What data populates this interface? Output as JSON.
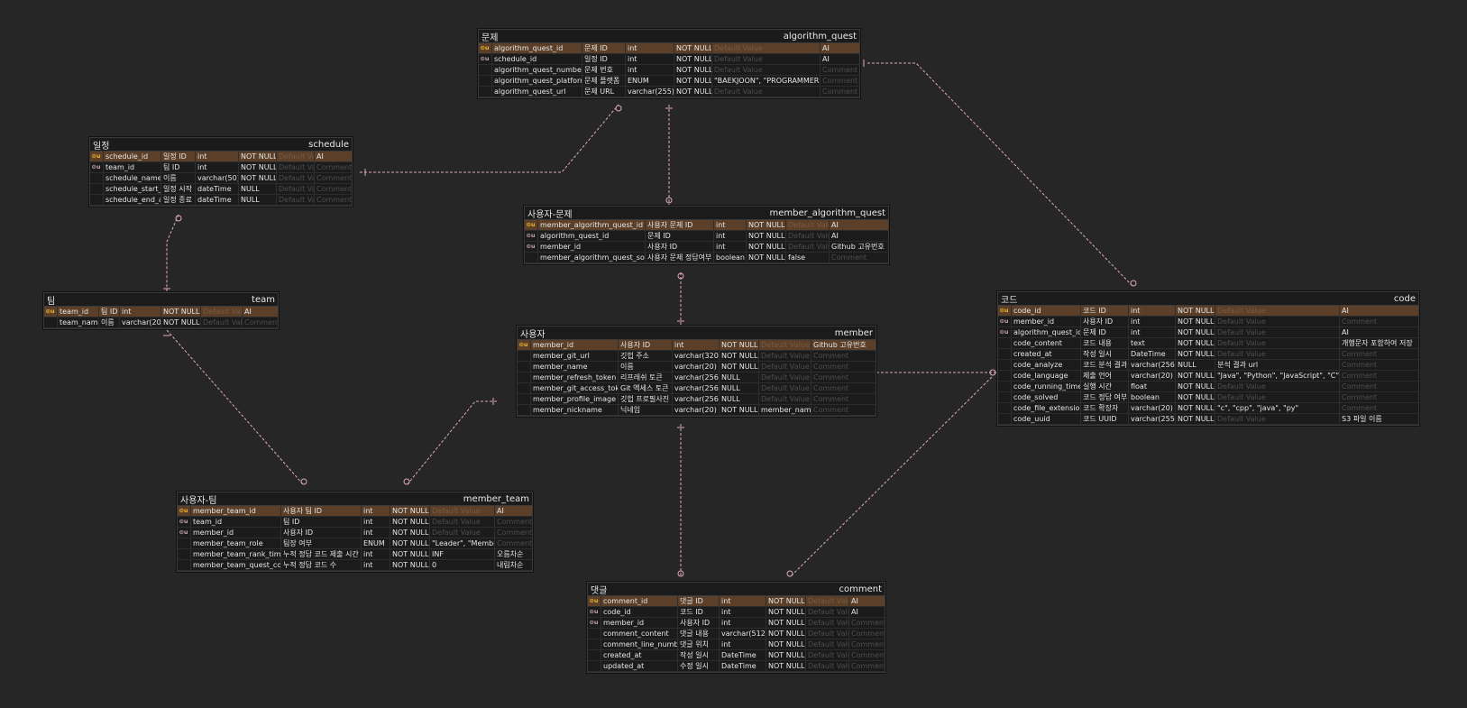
{
  "placeholders": {
    "default": "Default Value",
    "comment": "Comment"
  },
  "colors": {
    "background": "#262626",
    "table": "#1b1b1b",
    "pk_row": "#5b3f28",
    "relation": "#e0a8c0"
  },
  "tables": [
    {
      "id": "algorithm_quest",
      "label": "문제",
      "name": "algorithm_quest",
      "rows": [
        {
          "key": "pk",
          "col": "algorithm_quest_id",
          "logical": "문제 ID",
          "type": "int",
          "null": "NOT NULL",
          "def": "",
          "comment": "AI"
        },
        {
          "key": "fk",
          "col": "schedule_id",
          "logical": "일정 ID",
          "type": "int",
          "null": "NOT NULL",
          "def": "",
          "comment": "AI"
        },
        {
          "key": "",
          "col": "algorithm_quest_number",
          "logical": "문제 번호",
          "type": "int",
          "null": "NOT NULL",
          "def": "",
          "comment": ""
        },
        {
          "key": "",
          "col": "algorithm_quest_platform",
          "logical": "문제 플랫폼",
          "type": "ENUM",
          "null": "NOT NULL",
          "def": "\"BAEKJOON\", \"PROGRAMMERS\"",
          "comment": ""
        },
        {
          "key": "",
          "col": "algorithm_quest_url",
          "logical": "문제 URL",
          "type": "varchar(255)",
          "null": "NOT NULL",
          "def": "",
          "comment": ""
        }
      ]
    },
    {
      "id": "schedule",
      "label": "일정",
      "name": "schedule",
      "rows": [
        {
          "key": "pk",
          "col": "schedule_id",
          "logical": "일정 ID",
          "type": "int",
          "null": "NOT NULL",
          "def": "",
          "comment": "AI"
        },
        {
          "key": "fk",
          "col": "team_id",
          "logical": "팀 ID",
          "type": "int",
          "null": "NOT NULL",
          "def": "",
          "comment": ""
        },
        {
          "key": "",
          "col": "schedule_name",
          "logical": "이름",
          "type": "varchar(50)",
          "null": "NOT NULL",
          "def": "",
          "comment": ""
        },
        {
          "key": "",
          "col": "schedule_start_at",
          "logical": "일정 시작",
          "type": "dateTime",
          "null": "NULL",
          "def": "",
          "comment": ""
        },
        {
          "key": "",
          "col": "schedule_end_at",
          "logical": "일정 종료",
          "type": "dateTime",
          "null": "NULL",
          "def": "",
          "comment": ""
        }
      ]
    },
    {
      "id": "member_algorithm_quest",
      "label": "사용자-문제",
      "name": "member_algorithm_quest",
      "rows": [
        {
          "key": "pk",
          "col": "member_algorithm_quest_id",
          "logical": "사용자 문제 ID",
          "type": "int",
          "null": "NOT NULL",
          "def": "",
          "comment": "AI"
        },
        {
          "key": "fk",
          "col": "algorithm_quest_id",
          "logical": "문제 ID",
          "type": "int",
          "null": "NOT NULL",
          "def": "",
          "comment": "AI"
        },
        {
          "key": "fk",
          "col": "member_id",
          "logical": "사용자 ID",
          "type": "int",
          "null": "NOT NULL",
          "def": "",
          "comment": "Github 고유번호"
        },
        {
          "key": "",
          "col": "member_algorithm_quest_solved",
          "logical": "사용자 문제 정답여부",
          "type": "boolean",
          "null": "NOT NULL",
          "def": "false",
          "comment": ""
        }
      ]
    },
    {
      "id": "team",
      "label": "팀",
      "name": "team",
      "rows": [
        {
          "key": "pk",
          "col": "team_id",
          "logical": "팀 ID",
          "type": "int",
          "null": "NOT NULL",
          "def": "",
          "comment": "AI"
        },
        {
          "key": "",
          "col": "team_name",
          "logical": "이름",
          "type": "varchar(20)",
          "null": "NOT NULL",
          "def": "",
          "comment": ""
        }
      ]
    },
    {
      "id": "member",
      "label": "사용자",
      "name": "member",
      "rows": [
        {
          "key": "pk",
          "col": "member_id",
          "logical": "사용자 ID",
          "type": "int",
          "null": "NOT NULL",
          "def": "",
          "comment": "Github 고유번호"
        },
        {
          "key": "",
          "col": "member_git_url",
          "logical": "깃헙 주소",
          "type": "varchar(320)",
          "null": "NOT NULL",
          "def": "",
          "comment": ""
        },
        {
          "key": "",
          "col": "member_name",
          "logical": "이름",
          "type": "varchar(20)",
          "null": "NOT NULL",
          "def": "",
          "comment": ""
        },
        {
          "key": "",
          "col": "member_refresh_token",
          "logical": "리프레쉬 토큰",
          "type": "varchar(256)",
          "null": "NULL",
          "def": "",
          "comment": ""
        },
        {
          "key": "",
          "col": "member_git_access_token",
          "logical": "Git 엑세스 토큰",
          "type": "varchar(256)",
          "null": "NULL",
          "def": "",
          "comment": ""
        },
        {
          "key": "",
          "col": "member_profile_image",
          "logical": "깃헙 프로필사진",
          "type": "varchar(256)",
          "null": "NULL",
          "def": "",
          "comment": ""
        },
        {
          "key": "",
          "col": "member_nickname",
          "logical": "닉네임",
          "type": "varchar(20)",
          "null": "NOT NULL",
          "def": "member_name",
          "comment": ""
        }
      ]
    },
    {
      "id": "code",
      "label": "코드",
      "name": "code",
      "rows": [
        {
          "key": "pk",
          "col": "code_id",
          "logical": "코드 ID",
          "type": "int",
          "null": "NOT NULL",
          "def": "",
          "comment": "AI"
        },
        {
          "key": "fk",
          "col": "member_id",
          "logical": "사용자 ID",
          "type": "int",
          "null": "NOT NULL",
          "def": "",
          "comment": ""
        },
        {
          "key": "fk",
          "col": "algorithm_quest_id",
          "logical": "문제 ID",
          "type": "int",
          "null": "NOT NULL",
          "def": "",
          "comment": "AI"
        },
        {
          "key": "",
          "col": "code_content",
          "logical": "코드 내용",
          "type": "text",
          "null": "NOT NULL",
          "def": "",
          "comment": "개행문자 포함하여 저장"
        },
        {
          "key": "",
          "col": "created_at",
          "logical": "작성 일시",
          "type": "DateTime",
          "null": "NOT NULL",
          "def": "",
          "comment": ""
        },
        {
          "key": "",
          "col": "code_analyze",
          "logical": "코드 분석 결과",
          "type": "varchar(256)",
          "null": "NULL",
          "def": "분석 결과 url",
          "comment": ""
        },
        {
          "key": "",
          "col": "code_language",
          "logical": "제출 언어",
          "type": "varchar(20)",
          "null": "NOT NULL",
          "def": "\"Java\", \"Python\", \"JavaScript\", \"C\", \"C++\"",
          "comment": ""
        },
        {
          "key": "",
          "col": "code_running_time",
          "logical": "실행 시간",
          "type": "float",
          "null": "NOT NULL",
          "def": "",
          "comment": ""
        },
        {
          "key": "",
          "col": "code_solved",
          "logical": "코드 정답 여부",
          "type": "boolean",
          "null": "NOT NULL",
          "def": "",
          "comment": ""
        },
        {
          "key": "",
          "col": "code_file_extension",
          "logical": "코드 확장자",
          "type": "varchar(20)",
          "null": "NOT NULL",
          "def": "\"c\", \"cpp\", \"java\", \"py\"",
          "comment": ""
        },
        {
          "key": "",
          "col": "code_uuid",
          "logical": "코드 UUID",
          "type": "varchar(255)",
          "null": "NOT NULL",
          "def": "",
          "comment": "S3 파일 이름"
        }
      ]
    },
    {
      "id": "member_team",
      "label": "사용자-팀",
      "name": "member_team",
      "rows": [
        {
          "key": "pk",
          "col": "member_team_id",
          "logical": "사용자 팀 ID",
          "type": "int",
          "null": "NOT NULL",
          "def": "",
          "comment": "AI"
        },
        {
          "key": "fk",
          "col": "team_id",
          "logical": "팀 ID",
          "type": "int",
          "null": "NOT NULL",
          "def": "",
          "comment": ""
        },
        {
          "key": "fk",
          "col": "member_id",
          "logical": "사용자 ID",
          "type": "int",
          "null": "NOT NULL",
          "def": "",
          "comment": ""
        },
        {
          "key": "",
          "col": "member_team_role",
          "logical": "팀장 여부",
          "type": "ENUM",
          "null": "NOT NULL",
          "def": "\"Leader\", \"Member\"",
          "comment": ""
        },
        {
          "key": "",
          "col": "member_team_rank_time",
          "logical": "누적 정답 코드 제출 시간",
          "type": "int",
          "null": "NOT NULL",
          "def": "INF",
          "comment": "오름차순"
        },
        {
          "key": "",
          "col": "member_team_quest_count",
          "logical": "누적 정답 코드 수",
          "type": "int",
          "null": "NOT NULL",
          "def": "0",
          "comment": "내림차순"
        }
      ]
    },
    {
      "id": "comment",
      "label": "댓글",
      "name": "comment",
      "rows": [
        {
          "key": "pk",
          "col": "comment_id",
          "logical": "댓글 ID",
          "type": "int",
          "null": "NOT NULL",
          "def": "",
          "comment": "AI"
        },
        {
          "key": "fk",
          "col": "code_id",
          "logical": "코드 ID",
          "type": "int",
          "null": "NOT NULL",
          "def": "",
          "comment": "AI"
        },
        {
          "key": "fk",
          "col": "member_id",
          "logical": "사용자 ID",
          "type": "int",
          "null": "NOT NULL",
          "def": "",
          "comment": ""
        },
        {
          "key": "",
          "col": "comment_content",
          "logical": "댓글 내용",
          "type": "varchar(512)",
          "null": "NOT NULL",
          "def": "",
          "comment": ""
        },
        {
          "key": "",
          "col": "comment_line_number",
          "logical": "댓글 위치",
          "type": "int",
          "null": "NOT NULL",
          "def": "",
          "comment": ""
        },
        {
          "key": "",
          "col": "created_at",
          "logical": "작성 일시",
          "type": "DateTime",
          "null": "NOT NULL",
          "def": "",
          "comment": ""
        },
        {
          "key": "",
          "col": "updated_at",
          "logical": "수정 일시",
          "type": "DateTime",
          "null": "NOT NULL",
          "def": "",
          "comment": ""
        }
      ]
    }
  ]
}
